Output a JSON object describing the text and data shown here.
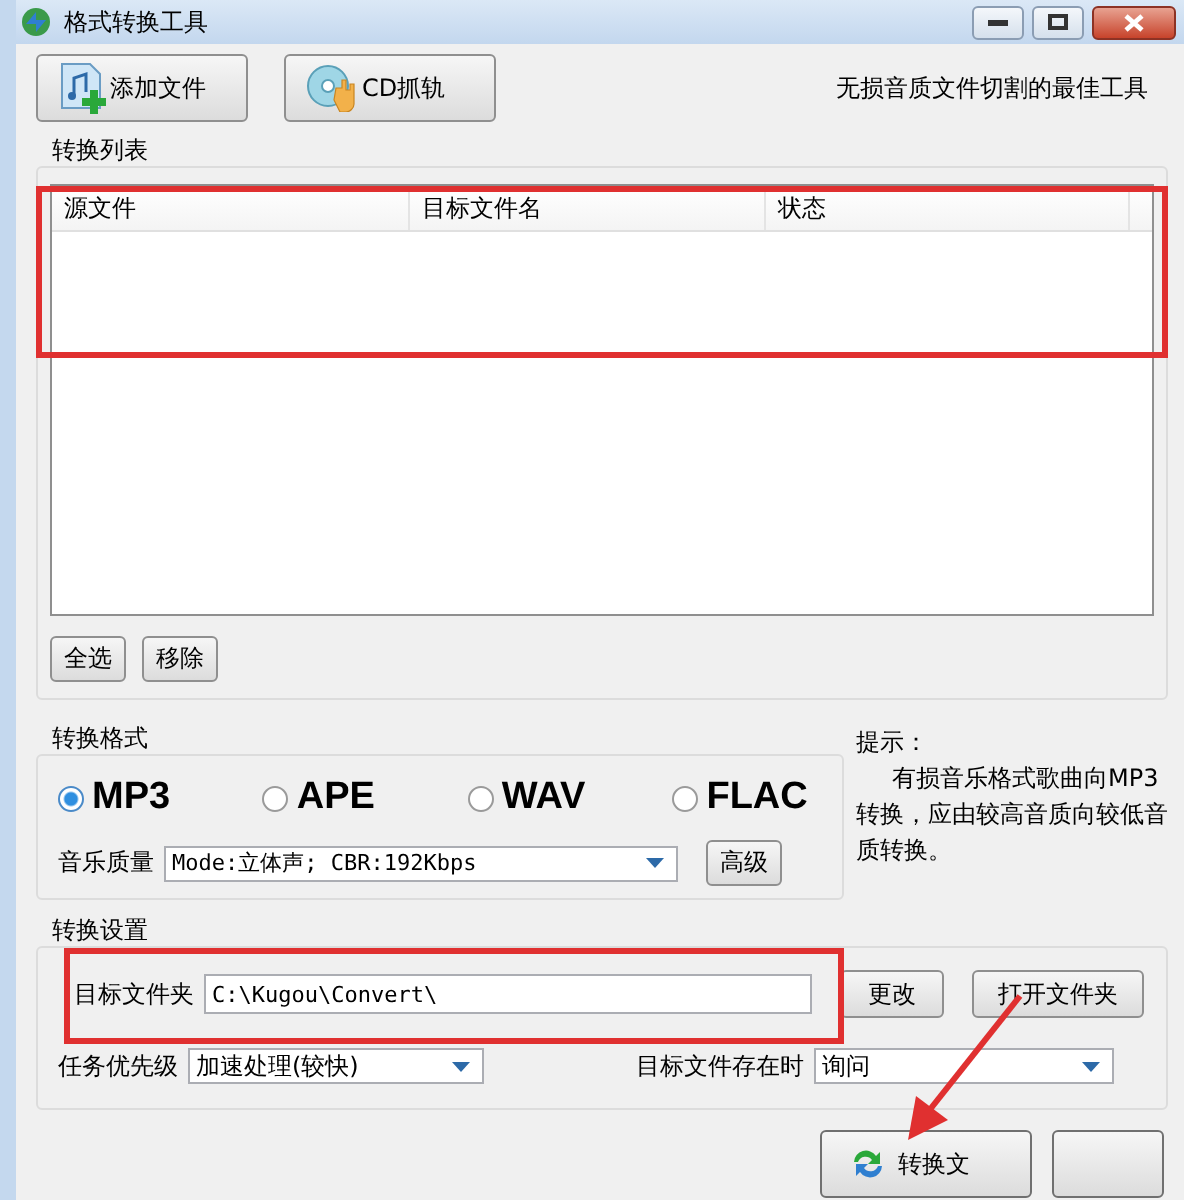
{
  "window": {
    "title": "格式转换工具"
  },
  "toolbar": {
    "buttons": [
      {
        "label": "添加文件",
        "kind": "add"
      },
      {
        "label": "CD抓轨",
        "kind": "cd"
      }
    ],
    "slogan": "无损音质文件切割的最佳工具"
  },
  "list_group": {
    "title": "转换列表",
    "columns": [
      "源文件",
      "目标文件名",
      "状态"
    ],
    "buttons": [
      "全选",
      "移除"
    ]
  },
  "format_group": {
    "title": "转换格式",
    "formats": [
      {
        "label": "MP3",
        "selected": true
      },
      {
        "label": "APE",
        "selected": false
      },
      {
        "label": "WAV",
        "selected": false
      },
      {
        "label": "FLAC",
        "selected": false
      }
    ],
    "quality": {
      "label": "音乐质量",
      "value": "Mode:立体声; CBR:192Kbps"
    },
    "advanced_button": "高级"
  },
  "hint": {
    "title": "提示：",
    "text": "有损音乐格式歌曲向MP3转换，应由较高音质向较低音质转换。"
  },
  "settings_group": {
    "title": "转换设置",
    "folder": {
      "label": "目标文件夹",
      "value": "C:\\Kugou\\Convert\\"
    },
    "change_button": "更改",
    "open_button": "打开文件夹",
    "priority": {
      "label": "任务优先级",
      "value": "加速处理(较快)"
    },
    "exists": {
      "label": "目标文件存在时",
      "value": "询问"
    }
  },
  "actions": [
    {
      "kind": "convert",
      "label": "转换文"
    },
    {
      "kind": "exit"
    }
  ]
}
